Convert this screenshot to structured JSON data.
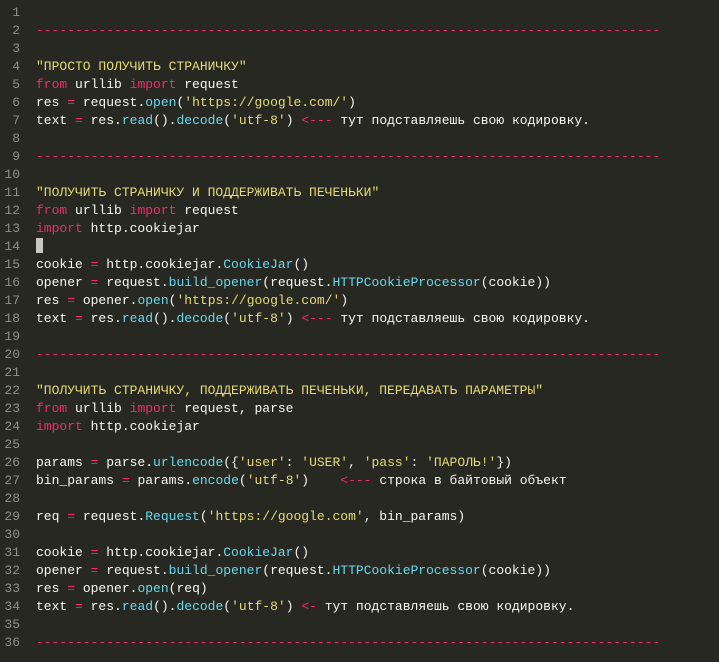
{
  "lines": [
    {
      "n": 1,
      "tokens": []
    },
    {
      "n": 2,
      "tokens": [
        {
          "c": "tok-sep",
          "t": "--------------------------------------------------------------------------------"
        }
      ]
    },
    {
      "n": 3,
      "tokens": []
    },
    {
      "n": 4,
      "tokens": [
        {
          "c": "tok-str",
          "t": "\"ПРОСТО ПОЛУЧИТЬ СТРАНИЧКУ\""
        }
      ]
    },
    {
      "n": 5,
      "tokens": [
        {
          "c": "tok-kw",
          "t": "from"
        },
        {
          "c": "tok-name",
          "t": " urllib "
        },
        {
          "c": "tok-kw",
          "t": "import"
        },
        {
          "c": "tok-name",
          "t": " request"
        }
      ]
    },
    {
      "n": 6,
      "tokens": [
        {
          "c": "tok-name",
          "t": "res "
        },
        {
          "c": "tok-eq",
          "t": "="
        },
        {
          "c": "tok-name",
          "t": " request."
        },
        {
          "c": "tok-call",
          "t": "open"
        },
        {
          "c": "tok-pun",
          "t": "("
        },
        {
          "c": "tok-str",
          "t": "'https://google.com/'"
        },
        {
          "c": "tok-pun",
          "t": ")"
        }
      ]
    },
    {
      "n": 7,
      "tokens": [
        {
          "c": "tok-name",
          "t": "text "
        },
        {
          "c": "tok-eq",
          "t": "="
        },
        {
          "c": "tok-name",
          "t": " res."
        },
        {
          "c": "tok-call",
          "t": "read"
        },
        {
          "c": "tok-pun",
          "t": "()."
        },
        {
          "c": "tok-call",
          "t": "decode"
        },
        {
          "c": "tok-pun",
          "t": "("
        },
        {
          "c": "tok-str",
          "t": "'utf-8'"
        },
        {
          "c": "tok-pun",
          "t": ") "
        },
        {
          "c": "tok-arrow",
          "t": "<---"
        },
        {
          "c": "tok-name",
          "t": " тут подставляешь свою кодировку."
        }
      ]
    },
    {
      "n": 8,
      "tokens": []
    },
    {
      "n": 9,
      "tokens": [
        {
          "c": "tok-sep",
          "t": "--------------------------------------------------------------------------------"
        }
      ]
    },
    {
      "n": 10,
      "tokens": []
    },
    {
      "n": 11,
      "tokens": [
        {
          "c": "tok-str",
          "t": "\"ПОЛУЧИТЬ СТРАНИЧКУ И ПОДДЕРЖИВАТЬ ПЕЧЕНЬКИ\""
        }
      ]
    },
    {
      "n": 12,
      "tokens": [
        {
          "c": "tok-kw",
          "t": "from"
        },
        {
          "c": "tok-name",
          "t": " urllib "
        },
        {
          "c": "tok-kw",
          "t": "import"
        },
        {
          "c": "tok-name",
          "t": " request"
        }
      ]
    },
    {
      "n": 13,
      "tokens": [
        {
          "c": "tok-kw",
          "t": "import"
        },
        {
          "c": "tok-name",
          "t": " http.cookiejar"
        }
      ]
    },
    {
      "n": 14,
      "tokens": [
        {
          "c": "cursor",
          "t": ""
        }
      ]
    },
    {
      "n": 15,
      "tokens": [
        {
          "c": "tok-name",
          "t": "cookie "
        },
        {
          "c": "tok-eq",
          "t": "="
        },
        {
          "c": "tok-name",
          "t": " http.cookiejar."
        },
        {
          "c": "tok-call",
          "t": "CookieJar"
        },
        {
          "c": "tok-pun",
          "t": "()"
        }
      ]
    },
    {
      "n": 16,
      "tokens": [
        {
          "c": "tok-name",
          "t": "opener "
        },
        {
          "c": "tok-eq",
          "t": "="
        },
        {
          "c": "tok-name",
          "t": " request."
        },
        {
          "c": "tok-call",
          "t": "build_opener"
        },
        {
          "c": "tok-pun",
          "t": "(request."
        },
        {
          "c": "tok-call",
          "t": "HTTPCookieProcessor"
        },
        {
          "c": "tok-pun",
          "t": "(cookie))"
        }
      ]
    },
    {
      "n": 17,
      "tokens": [
        {
          "c": "tok-name",
          "t": "res "
        },
        {
          "c": "tok-eq",
          "t": "="
        },
        {
          "c": "tok-name",
          "t": " opener."
        },
        {
          "c": "tok-call",
          "t": "open"
        },
        {
          "c": "tok-pun",
          "t": "("
        },
        {
          "c": "tok-str",
          "t": "'https://google.com/'"
        },
        {
          "c": "tok-pun",
          "t": ")"
        }
      ]
    },
    {
      "n": 18,
      "tokens": [
        {
          "c": "tok-name",
          "t": "text "
        },
        {
          "c": "tok-eq",
          "t": "="
        },
        {
          "c": "tok-name",
          "t": " res."
        },
        {
          "c": "tok-call",
          "t": "read"
        },
        {
          "c": "tok-pun",
          "t": "()."
        },
        {
          "c": "tok-call",
          "t": "decode"
        },
        {
          "c": "tok-pun",
          "t": "("
        },
        {
          "c": "tok-str",
          "t": "'utf-8'"
        },
        {
          "c": "tok-pun",
          "t": ") "
        },
        {
          "c": "tok-arrow",
          "t": "<---"
        },
        {
          "c": "tok-name",
          "t": " тут подставляешь свою кодировку."
        }
      ]
    },
    {
      "n": 19,
      "tokens": []
    },
    {
      "n": 20,
      "tokens": [
        {
          "c": "tok-sep",
          "t": "--------------------------------------------------------------------------------"
        }
      ]
    },
    {
      "n": 21,
      "tokens": []
    },
    {
      "n": 22,
      "tokens": [
        {
          "c": "tok-str",
          "t": "\"ПОЛУЧИТЬ СТРАНИЧКУ, ПОДДЕРЖИВАТЬ ПЕЧЕНЬКИ, ПЕРЕДАВАТЬ ПАРАМЕТРЫ\""
        }
      ]
    },
    {
      "n": 23,
      "tokens": [
        {
          "c": "tok-kw",
          "t": "from"
        },
        {
          "c": "tok-name",
          "t": " urllib "
        },
        {
          "c": "tok-kw",
          "t": "import"
        },
        {
          "c": "tok-name",
          "t": " request, parse"
        }
      ]
    },
    {
      "n": 24,
      "tokens": [
        {
          "c": "tok-kw",
          "t": "import"
        },
        {
          "c": "tok-name",
          "t": " http.cookiejar"
        }
      ]
    },
    {
      "n": 25,
      "tokens": []
    },
    {
      "n": 26,
      "tokens": [
        {
          "c": "tok-name",
          "t": "params "
        },
        {
          "c": "tok-eq",
          "t": "="
        },
        {
          "c": "tok-name",
          "t": " parse."
        },
        {
          "c": "tok-call",
          "t": "urlencode"
        },
        {
          "c": "tok-pun",
          "t": "({"
        },
        {
          "c": "tok-str",
          "t": "'user'"
        },
        {
          "c": "tok-pun",
          "t": ": "
        },
        {
          "c": "tok-str",
          "t": "'USER'"
        },
        {
          "c": "tok-pun",
          "t": ", "
        },
        {
          "c": "tok-str",
          "t": "'pass'"
        },
        {
          "c": "tok-pun",
          "t": ": "
        },
        {
          "c": "tok-str",
          "t": "'ПАРОЛЬ!'"
        },
        {
          "c": "tok-pun",
          "t": "})"
        }
      ]
    },
    {
      "n": 27,
      "tokens": [
        {
          "c": "tok-name",
          "t": "bin_params "
        },
        {
          "c": "tok-eq",
          "t": "="
        },
        {
          "c": "tok-name",
          "t": " params."
        },
        {
          "c": "tok-call",
          "t": "encode"
        },
        {
          "c": "tok-pun",
          "t": "("
        },
        {
          "c": "tok-str",
          "t": "'utf-8'"
        },
        {
          "c": "tok-pun",
          "t": ")    "
        },
        {
          "c": "tok-arrow",
          "t": "<---"
        },
        {
          "c": "tok-name",
          "t": " строка в байтовый объект"
        }
      ]
    },
    {
      "n": 28,
      "tokens": []
    },
    {
      "n": 29,
      "tokens": [
        {
          "c": "tok-name",
          "t": "req "
        },
        {
          "c": "tok-eq",
          "t": "="
        },
        {
          "c": "tok-name",
          "t": " request."
        },
        {
          "c": "tok-call",
          "t": "Request"
        },
        {
          "c": "tok-pun",
          "t": "("
        },
        {
          "c": "tok-str",
          "t": "'https://google.com'"
        },
        {
          "c": "tok-pun",
          "t": ", bin_params)"
        }
      ]
    },
    {
      "n": 30,
      "tokens": []
    },
    {
      "n": 31,
      "tokens": [
        {
          "c": "tok-name",
          "t": "cookie "
        },
        {
          "c": "tok-eq",
          "t": "="
        },
        {
          "c": "tok-name",
          "t": " http.cookiejar."
        },
        {
          "c": "tok-call",
          "t": "CookieJar"
        },
        {
          "c": "tok-pun",
          "t": "()"
        }
      ]
    },
    {
      "n": 32,
      "tokens": [
        {
          "c": "tok-name",
          "t": "opener "
        },
        {
          "c": "tok-eq",
          "t": "="
        },
        {
          "c": "tok-name",
          "t": " request."
        },
        {
          "c": "tok-call",
          "t": "build_opener"
        },
        {
          "c": "tok-pun",
          "t": "(request."
        },
        {
          "c": "tok-call",
          "t": "HTTPCookieProcessor"
        },
        {
          "c": "tok-pun",
          "t": "(cookie))"
        }
      ]
    },
    {
      "n": 33,
      "tokens": [
        {
          "c": "tok-name",
          "t": "res "
        },
        {
          "c": "tok-eq",
          "t": "="
        },
        {
          "c": "tok-name",
          "t": " opener."
        },
        {
          "c": "tok-call",
          "t": "open"
        },
        {
          "c": "tok-pun",
          "t": "(req)"
        }
      ]
    },
    {
      "n": 34,
      "tokens": [
        {
          "c": "tok-name",
          "t": "text "
        },
        {
          "c": "tok-eq",
          "t": "="
        },
        {
          "c": "tok-name",
          "t": " res."
        },
        {
          "c": "tok-call",
          "t": "read"
        },
        {
          "c": "tok-pun",
          "t": "()."
        },
        {
          "c": "tok-call",
          "t": "decode"
        },
        {
          "c": "tok-pun",
          "t": "("
        },
        {
          "c": "tok-str",
          "t": "'utf-8'"
        },
        {
          "c": "tok-pun",
          "t": ") "
        },
        {
          "c": "tok-arrow",
          "t": "<-"
        },
        {
          "c": "tok-name",
          "t": " тут подставляешь свою кодировку."
        }
      ]
    },
    {
      "n": 35,
      "tokens": []
    },
    {
      "n": 36,
      "tokens": [
        {
          "c": "tok-sep",
          "t": "--------------------------------------------------------------------------------"
        }
      ]
    }
  ]
}
